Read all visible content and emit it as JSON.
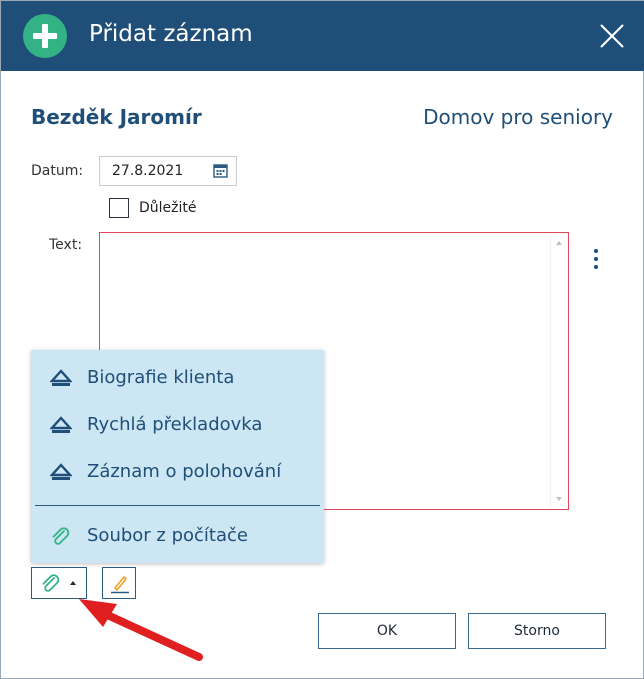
{
  "dialog": {
    "title": "Přidat záznam"
  },
  "header": {
    "client_name": "Bezděk Jaromír",
    "facility": "Domov pro seniory"
  },
  "form": {
    "date_label": "Datum:",
    "date_value": "27.8.2021",
    "important_label": "Důležité",
    "important_checked": false,
    "text_label": "Text:",
    "text_value": ""
  },
  "menu": {
    "items": [
      {
        "label": "Biografie klienta",
        "icon": "template-icon"
      },
      {
        "label": "Rychlá překladovka",
        "icon": "template-icon"
      },
      {
        "label": "Záznam o polohování",
        "icon": "template-icon"
      },
      {
        "label": "Soubor z počítače",
        "icon": "paperclip-icon"
      }
    ]
  },
  "buttons": {
    "ok": "OK",
    "cancel": "Storno"
  },
  "colors": {
    "titlebar": "#1f4f78",
    "accent_green": "#33b385",
    "menu_background": "#cde6f4",
    "error_border": "#e0495a",
    "annotation_arrow": "#e02020"
  }
}
